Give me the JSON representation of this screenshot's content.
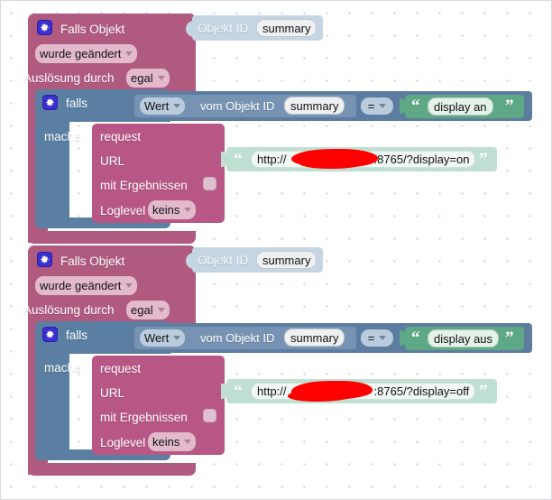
{
  "app": {
    "name": "blockly-script-editor",
    "canvas_background": "#ffffff",
    "grid_dot_color": "#cfcfd6"
  },
  "colors": {
    "event_block": "#b05a80",
    "control_block": "#5a7fa3",
    "request_block": "#b85685",
    "value_block": "#c5d5e4",
    "getvalue_block": "#7793b3",
    "compare_block": "#5c7ca0",
    "string_block": "#5fa886",
    "url_string_block": "#bedfd1",
    "gear_icon": "#3b2fcf",
    "redaction": "#fe0000"
  },
  "scripts": [
    {
      "id": "script-on",
      "event": {
        "title": "Falls Objekt",
        "gear_icon": "gear-icon",
        "condition_label": "wurde geändert",
        "trigger_prefix": "Auslösung durch",
        "trigger_value": "egal",
        "object_socket": {
          "label": "Objekt ID",
          "value": "summary"
        }
      },
      "control": {
        "title": "falls",
        "gear_icon": "gear-icon",
        "do_label": "mache",
        "condition": {
          "source_mode": "Wert",
          "middle_label": "vom Objekt ID",
          "object_id": "summary",
          "operator": "=",
          "compare_value": "display an"
        }
      },
      "action": {
        "title": "request",
        "url_label": "URL",
        "with_results_label": "mit Ergebnissen",
        "with_results_checked": false,
        "loglevel_label": "Loglevel",
        "loglevel_value": "keins",
        "url_prefix": "http://",
        "url_redacted": true,
        "url_suffix": ":8765/?display=on"
      }
    },
    {
      "id": "script-off",
      "event": {
        "title": "Falls Objekt",
        "gear_icon": "gear-icon",
        "condition_label": "wurde geändert",
        "trigger_prefix": "Auslösung durch",
        "trigger_value": "egal",
        "object_socket": {
          "label": "Objekt ID",
          "value": "summary"
        }
      },
      "control": {
        "title": "falls",
        "gear_icon": "gear-icon",
        "do_label": "mache",
        "condition": {
          "source_mode": "Wert",
          "middle_label": "vom Objekt ID",
          "object_id": "summary",
          "operator": "=",
          "compare_value": "display aus"
        }
      },
      "action": {
        "title": "request",
        "url_label": "URL",
        "with_results_label": "mit Ergebnissen",
        "with_results_checked": false,
        "loglevel_label": "Loglevel",
        "loglevel_value": "keins",
        "url_prefix": "http://",
        "url_redacted": true,
        "url_suffix": ":8765/?display=off"
      }
    }
  ],
  "glyphs": {
    "quote_open": "“",
    "quote_close": "”"
  }
}
